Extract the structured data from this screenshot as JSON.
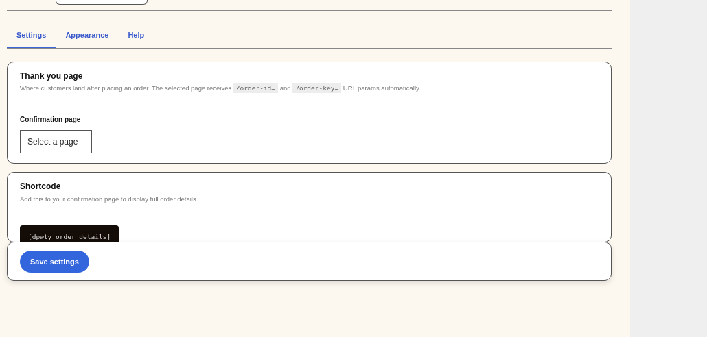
{
  "tabs": [
    {
      "label": "Settings",
      "selected": true
    },
    {
      "label": "Appearance",
      "selected": false
    },
    {
      "label": "Help",
      "selected": false
    }
  ],
  "sections": [
    {
      "title": "Thank you page",
      "description": [
        {
          "kind": "text",
          "text": "Where customers land after placing an order. The selected page receives "
        },
        {
          "kind": "code",
          "text": "?order-id="
        },
        {
          "kind": "text",
          "text": " and "
        },
        {
          "kind": "code",
          "text": "?order-key="
        },
        {
          "kind": "text",
          "text": " URL params automatically."
        }
      ],
      "field": {
        "label": "Confirmation page",
        "value": "Select a page"
      }
    },
    {
      "title": "Shortcode",
      "description": [
        {
          "kind": "text",
          "text": "Add this to your confirmation page to display full order details."
        }
      ],
      "shortcode": "[dpwty_order_details]"
    }
  ],
  "save_button": "Save settings"
}
